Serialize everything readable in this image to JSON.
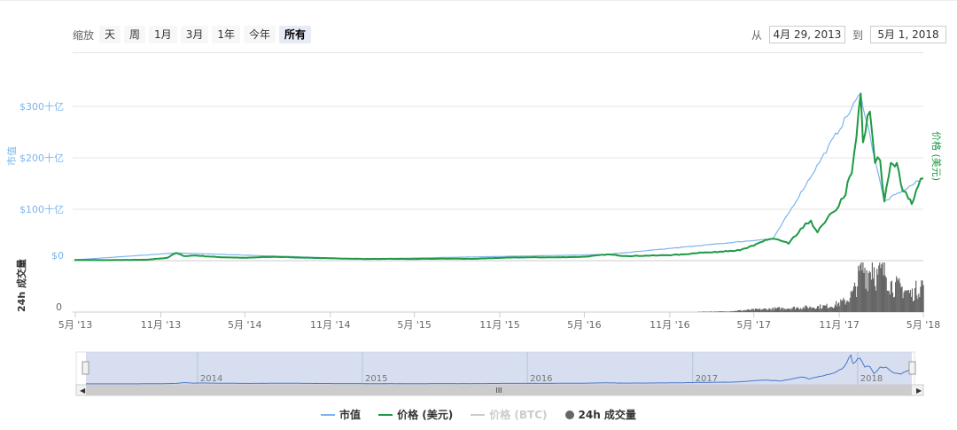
{
  "toolbar": {
    "zoom_label": "缩放",
    "zoom_buttons": [
      "天",
      "周",
      "1月",
      "3月",
      "1年",
      "今年",
      "所有"
    ],
    "active_zoom": "所有",
    "from_label": "从",
    "to_label": "到",
    "from_value": "4月 29, 2013",
    "to_value": "5月 1, 2018"
  },
  "navigator": {
    "year_labels": [
      "2014",
      "2015",
      "2016",
      "2017",
      "2018"
    ],
    "grip_glyph": "III"
  },
  "legend": {
    "market_cap": "市值",
    "price_usd": "价格 (美元)",
    "price_btc": "价格 (BTC)",
    "volume_24h": "24h 成交量"
  },
  "colors": {
    "market_cap": "#7cb5ec",
    "price_usd": "#1e9a45",
    "price_btc": "#cccccc",
    "volume": "#666666",
    "navigator_fill": "#ccd6eb"
  },
  "chart_data": {
    "type": "line",
    "title": "",
    "x_range": [
      "2013-04-29",
      "2018-05-01"
    ],
    "x_tick_labels": [
      "5月 '13",
      "11月 '13",
      "5月 '14",
      "11月 '14",
      "5月 '15",
      "11月 '15",
      "5月 '16",
      "11月 '16",
      "5月 '17",
      "11月 '17",
      "5月 '18"
    ],
    "left_axis": {
      "label": "市值",
      "ticks": [
        "$0",
        "$100十亿",
        "$200十亿",
        "$300十亿"
      ],
      "tick_values": [
        0,
        100,
        200,
        300
      ],
      "unit": "十亿 USD"
    },
    "right_axis": {
      "label": "价格 (美元)"
    },
    "volume_axis": {
      "label": "24h 成交量",
      "ticks": [
        "0"
      ]
    },
    "series": [
      {
        "name": "价格 (美元)",
        "x": [
          "2013-04-29",
          "2013-07-01",
          "2013-10-01",
          "2013-11-15",
          "2013-12-04",
          "2013-12-20",
          "2014-01-15",
          "2014-03-01",
          "2014-05-01",
          "2014-07-01",
          "2014-09-01",
          "2014-11-01",
          "2015-01-15",
          "2015-03-01",
          "2015-05-01",
          "2015-07-01",
          "2015-09-01",
          "2015-11-05",
          "2016-01-01",
          "2016-03-01",
          "2016-05-01",
          "2016-06-18",
          "2016-08-01",
          "2016-10-01",
          "2016-12-01",
          "2017-01-05",
          "2017-02-01",
          "2017-03-01",
          "2017-04-01",
          "2017-05-01",
          "2017-05-25",
          "2017-06-12",
          "2017-07-15",
          "2017-08-15",
          "2017-09-01",
          "2017-09-15",
          "2017-10-01",
          "2017-10-20",
          "2017-11-10",
          "2017-11-28",
          "2017-12-08",
          "2017-12-17",
          "2017-12-22",
          "2018-01-06",
          "2018-01-17",
          "2018-01-28",
          "2018-02-06",
          "2018-02-20",
          "2018-03-05",
          "2018-03-18",
          "2018-03-30",
          "2018-04-06",
          "2018-04-20",
          "2018-05-01"
        ],
        "values": [
          1.5,
          1.0,
          1.8,
          5.5,
          15,
          9,
          10,
          7,
          5.5,
          7.5,
          6,
          4.5,
          3.3,
          3.5,
          3.3,
          3.8,
          3.5,
          5.5,
          6.5,
          6.5,
          7.5,
          12,
          9,
          10,
          12,
          16,
          16,
          19,
          20,
          29,
          40,
          43,
          33,
          64,
          78,
          55,
          74,
          95,
          122,
          170,
          240,
          325,
          230,
          290,
          190,
          195,
          115,
          190,
          190,
          135,
          120,
          110,
          145,
          160
        ]
      },
      {
        "name": "市值",
        "x": [
          "2013-04-29",
          "2013-12-04",
          "2015-01-15",
          "2016-06-18",
          "2017-06-12",
          "2017-12-17",
          "2018-02-06",
          "2018-05-01"
        ],
        "values": [
          1.5,
          15,
          3.3,
          12,
          43,
          325,
          115,
          160
        ]
      },
      {
        "name": "24h 成交量",
        "x": [
          "2017-01-01",
          "2017-03-01",
          "2017-05-01",
          "2017-07-01",
          "2017-09-01",
          "2017-10-15",
          "2017-11-15",
          "2017-12-01",
          "2017-12-10",
          "2017-12-20",
          "2018-01-01",
          "2018-01-10",
          "2018-01-20",
          "2018-02-06",
          "2018-02-20",
          "2018-03-05",
          "2018-03-20",
          "2018-04-05",
          "2018-04-20",
          "2018-05-01"
        ],
        "values": [
          0.3,
          0.5,
          2,
          3,
          4,
          5,
          9,
          16,
          25,
          38,
          30,
          40,
          28,
          34,
          22,
          20,
          18,
          14,
          20,
          24
        ],
        "unit": "十亿 USD"
      }
    ],
    "grid": true,
    "legend_position": "bottom-center"
  }
}
